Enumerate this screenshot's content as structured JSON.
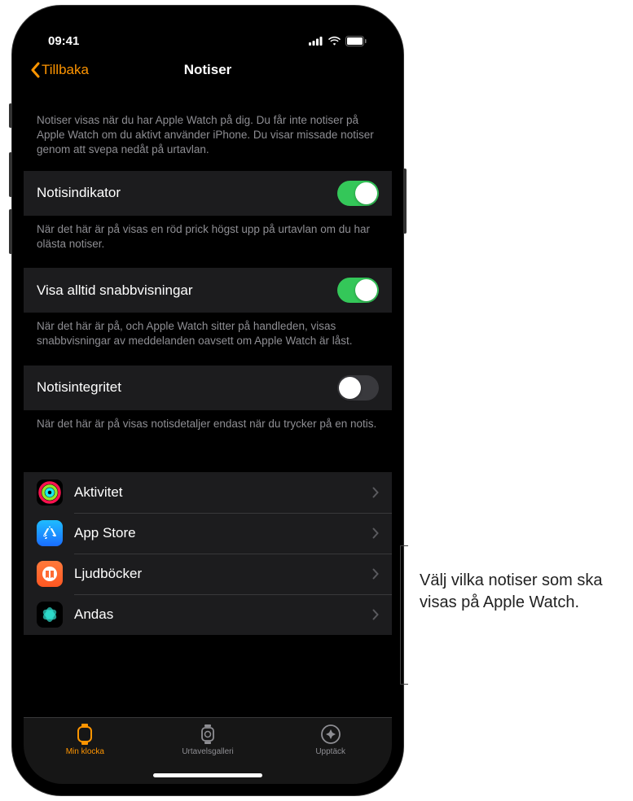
{
  "status": {
    "time": "09:41"
  },
  "nav": {
    "back": "Tillbaka",
    "title": "Notiser"
  },
  "intro": "Notiser visas när du har Apple Watch på dig. Du får inte notiser på Apple Watch om du aktivt använder iPhone. Du visar missade notiser genom att svepa nedåt på urtavlan.",
  "settings": [
    {
      "label": "Notisindikator",
      "on": true,
      "footer": "När det här är på visas en röd prick högst upp på urtavlan om du har olästa notiser."
    },
    {
      "label": "Visa alltid snabbvisningar",
      "on": true,
      "footer": "När det här är på, och Apple Watch sitter på handleden, visas snabbvisningar av meddelanden oavsett om Apple Watch är låst."
    },
    {
      "label": "Notisintegritet",
      "on": false,
      "footer": "När det här är på visas notisdetaljer endast när du trycker på en notis."
    }
  ],
  "apps": [
    {
      "name": "Aktivitet",
      "icon": "activity"
    },
    {
      "name": "App Store",
      "icon": "appstore"
    },
    {
      "name": "Ljudböcker",
      "icon": "audiobooks"
    },
    {
      "name": "Andas",
      "icon": "breathe"
    }
  ],
  "tabs": [
    {
      "label": "Min klocka",
      "active": true
    },
    {
      "label": "Urtavelsgalleri",
      "active": false
    },
    {
      "label": "Upptäck",
      "active": false
    }
  ],
  "callout": "Välj vilka notiser som ska visas på Apple Watch."
}
